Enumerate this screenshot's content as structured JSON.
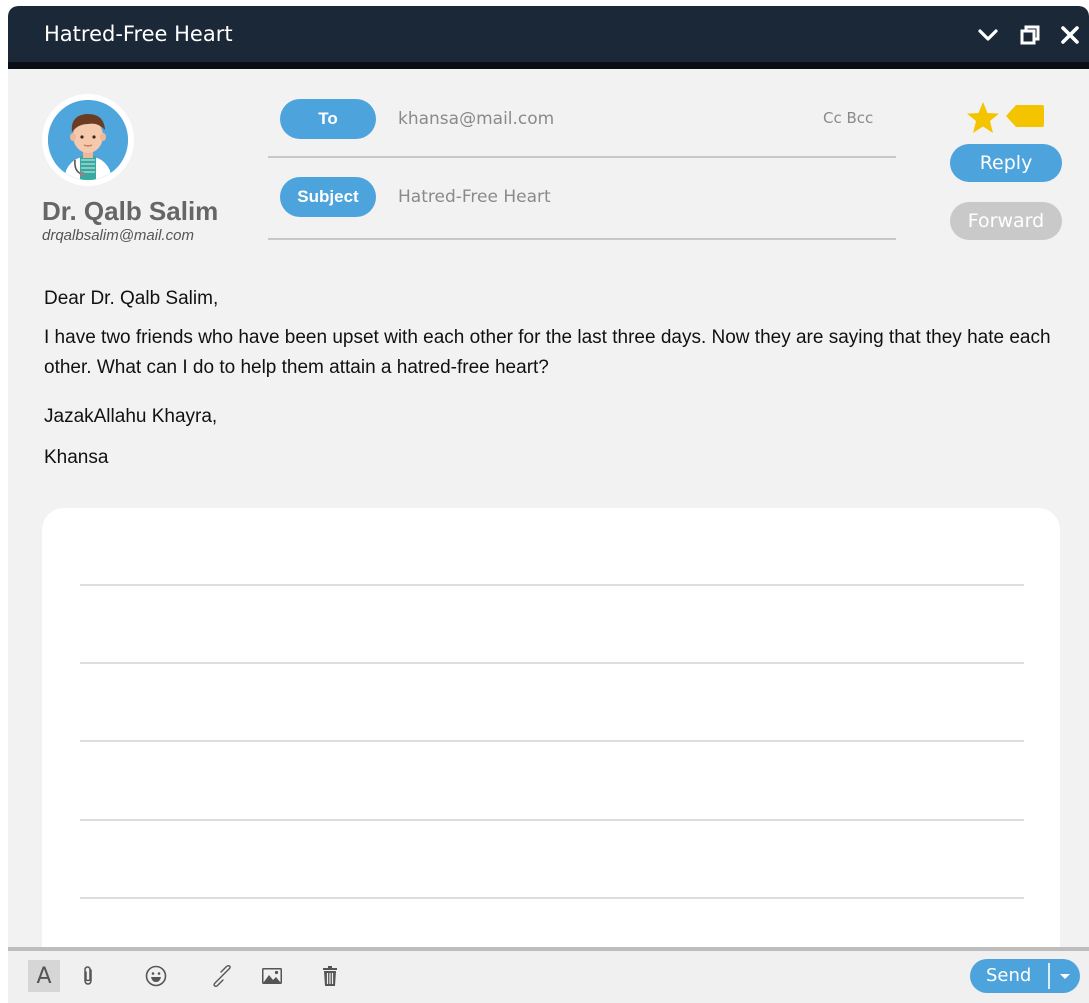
{
  "window": {
    "title": "Hatred-Free Heart",
    "controls": [
      "chevron-down-icon",
      "restore-icon",
      "close-icon"
    ]
  },
  "sender": {
    "name": "Dr. Qalb Salim",
    "email": "drqalbsalim@mail.com"
  },
  "header": {
    "to_label": "To",
    "to_value": "khansa@mail.com",
    "cc_bcc": "Cc Bcc",
    "subject_label": "Subject",
    "subject_value": "Hatred-Free Heart"
  },
  "actions": {
    "reply": "Reply",
    "forward": "Forward"
  },
  "message": {
    "greeting": "Dear Dr. Qalb Salim,",
    "body": "I have two friends who have been upset with each other for the last three days. Now they are saying that they hate each other. What can I do to help them attain a hatred-free heart?",
    "closing": "JazakAllahu Khayra,",
    "signature": "Khansa"
  },
  "toolbar": {
    "font_label": "A",
    "icons": [
      "font-icon",
      "attachment-icon",
      "emoji-icon",
      "link-icon",
      "image-icon",
      "trash-icon"
    ],
    "send": "Send"
  },
  "colors": {
    "titlebar": "#1b2838",
    "accent": "#4da3dc",
    "disabled": "#c9c9c9",
    "star": "#f5c400"
  }
}
